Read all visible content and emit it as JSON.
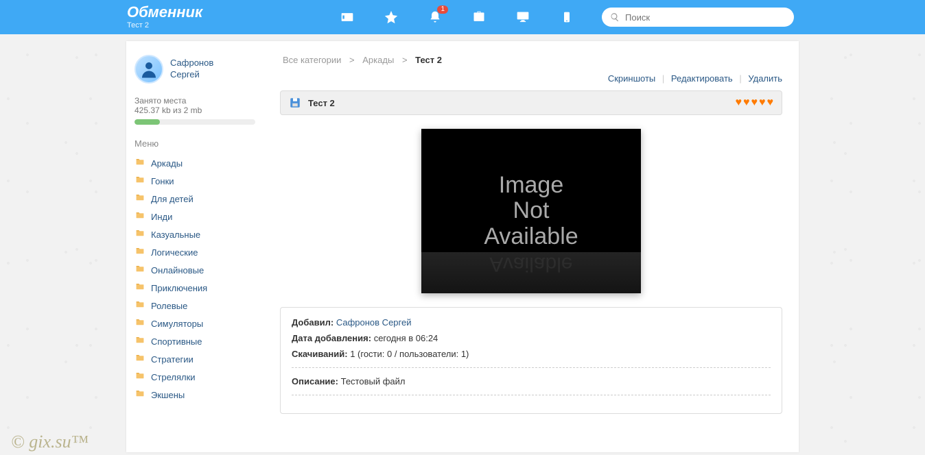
{
  "brand": {
    "title": "Обменник",
    "subtitle": "Тест 2"
  },
  "nav": {
    "notification_count": "1"
  },
  "search": {
    "placeholder": "Поиск"
  },
  "user": {
    "line1": "Сафронов",
    "line2": "Сергей"
  },
  "storage": {
    "label": "Занято места",
    "value": "425.37 kb из 2 mb",
    "percent": 21
  },
  "sidebar": {
    "heading": "Меню",
    "items": [
      {
        "label": "Аркады"
      },
      {
        "label": "Гонки"
      },
      {
        "label": "Для детей"
      },
      {
        "label": "Инди"
      },
      {
        "label": "Казуальные"
      },
      {
        "label": "Логические"
      },
      {
        "label": "Онлайновые"
      },
      {
        "label": "Приключения"
      },
      {
        "label": "Ролевые"
      },
      {
        "label": "Симуляторы"
      },
      {
        "label": "Спортивные"
      },
      {
        "label": "Стратегии"
      },
      {
        "label": "Стрелялки"
      },
      {
        "label": "Экшены"
      }
    ]
  },
  "breadcrumb": {
    "root": "Все категории",
    "cat": "Аркады",
    "current": "Тест 2"
  },
  "actions": {
    "screenshots": "Скриншоты",
    "edit": "Редактировать",
    "delete": "Удалить"
  },
  "titlebar": {
    "title": "Тест 2",
    "hearts": 5
  },
  "preview": {
    "line1": "Image",
    "line2": "Not",
    "line3": "Available"
  },
  "info": {
    "added_label": "Добавил:",
    "added_by": "Сафронов Сергей",
    "date_label": "Дата добавления:",
    "date_value": "сегодня в 06:24",
    "downloads_label": "Скачиваний:",
    "downloads_value": "1 (гости: 0 / пользователи: 1)",
    "desc_label": "Описание:",
    "desc_value": "Тестовый файл"
  },
  "watermark": "© gix.su™"
}
